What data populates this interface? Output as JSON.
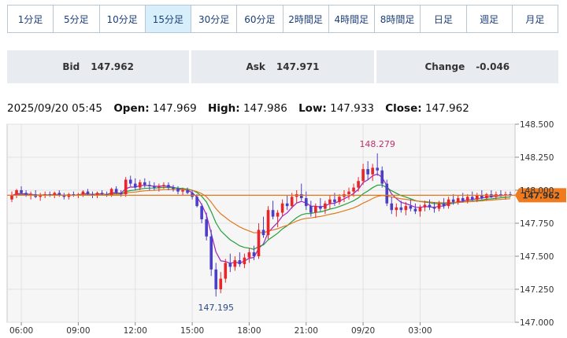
{
  "timeframes": [
    {
      "label": "1分足",
      "active": false
    },
    {
      "label": "5分足",
      "active": false
    },
    {
      "label": "10分足",
      "active": false
    },
    {
      "label": "15分足",
      "active": true
    },
    {
      "label": "30分足",
      "active": false
    },
    {
      "label": "60分足",
      "active": false
    },
    {
      "label": "2時間足",
      "active": false
    },
    {
      "label": "4時間足",
      "active": false
    },
    {
      "label": "8時間足",
      "active": false
    },
    {
      "label": "日足",
      "active": false
    },
    {
      "label": "週足",
      "active": false
    },
    {
      "label": "月足",
      "active": false
    }
  ],
  "quotes": {
    "bid": {
      "label": "Bid",
      "value": "147.962"
    },
    "ask": {
      "label": "Ask",
      "value": "147.971"
    },
    "change": {
      "label": "Change",
      "value": "-0.046"
    }
  },
  "ohlc": {
    "datetime": "2025/09/20 05:45",
    "open_label": "Open:",
    "open": "147.969",
    "high_label": "High:",
    "high": "147.986",
    "low_label": "Low:",
    "low": "147.933",
    "close_label": "Close:",
    "close": "147.962"
  },
  "colors": {
    "up": "#e8262a",
    "down": "#4b3fc8",
    "ma_short": "#a020c0",
    "ma_mid": "#22a03a",
    "ma_long": "#e07a20",
    "price_line": "#e8741a",
    "price_tag": "#f07a1e",
    "high_annotation": "#c0306a",
    "low_annotation": "#2a4a8a",
    "tab_active_bg": "#d6effa"
  },
  "chart_data": {
    "type": "candlestick",
    "ylim": [
      147.0,
      148.5
    ],
    "y_ticks": [
      "148.500",
      "148.250",
      "148.000",
      "147.750",
      "147.500",
      "147.250",
      "147.000"
    ],
    "x_ticks": [
      "06:00",
      "09:00",
      "12:00",
      "15:00",
      "18:00",
      "21:00",
      "09/20",
      "03:00"
    ],
    "current_price": "147.962",
    "annotations": [
      {
        "text": "148.279",
        "kind": "high",
        "value": 148.279
      },
      {
        "text": "147.195",
        "kind": "low",
        "value": 147.195
      }
    ],
    "candles": [
      [
        147.93,
        147.99,
        147.91,
        147.96
      ],
      [
        147.96,
        148.01,
        147.94,
        148.0
      ],
      [
        148.0,
        148.03,
        147.97,
        147.98
      ],
      [
        147.98,
        148.0,
        147.95,
        147.96
      ],
      [
        147.96,
        147.99,
        147.93,
        147.97
      ],
      [
        147.97,
        148.0,
        147.94,
        147.95
      ],
      [
        147.95,
        147.98,
        147.92,
        147.96
      ],
      [
        147.96,
        147.99,
        147.94,
        147.97
      ],
      [
        147.97,
        147.99,
        147.95,
        147.96
      ],
      [
        147.96,
        147.99,
        147.94,
        147.98
      ],
      [
        147.98,
        148.0,
        147.95,
        147.96
      ],
      [
        147.96,
        147.98,
        147.93,
        147.95
      ],
      [
        147.95,
        147.98,
        147.93,
        147.97
      ],
      [
        147.97,
        147.99,
        147.95,
        147.96
      ],
      [
        147.96,
        147.98,
        147.94,
        147.97
      ],
      [
        147.97,
        148.0,
        147.95,
        147.99
      ],
      [
        147.99,
        148.01,
        147.96,
        147.97
      ],
      [
        147.97,
        147.99,
        147.94,
        147.96
      ],
      [
        147.96,
        147.99,
        147.94,
        147.98
      ],
      [
        147.98,
        148.0,
        147.96,
        147.97
      ],
      [
        147.97,
        147.99,
        147.95,
        147.96
      ],
      [
        147.96,
        148.02,
        147.95,
        148.01
      ],
      [
        148.01,
        148.03,
        147.97,
        147.98
      ],
      [
        147.98,
        148.0,
        147.95,
        147.97
      ],
      [
        147.97,
        148.1,
        147.95,
        148.08
      ],
      [
        148.08,
        148.11,
        148.03,
        148.05
      ],
      [
        148.05,
        148.09,
        148.0,
        148.02
      ],
      [
        148.02,
        148.08,
        148.0,
        148.06
      ],
      [
        148.06,
        148.09,
        148.02,
        148.04
      ],
      [
        148.04,
        148.07,
        148.0,
        148.03
      ],
      [
        148.03,
        148.06,
        148.0,
        148.02
      ],
      [
        148.02,
        148.05,
        147.99,
        148.03
      ],
      [
        148.03,
        148.06,
        148.01,
        148.04
      ],
      [
        148.04,
        148.06,
        148.0,
        148.02
      ],
      [
        148.02,
        148.04,
        147.99,
        148.01
      ],
      [
        148.01,
        148.03,
        147.97,
        147.99
      ],
      [
        147.99,
        148.02,
        147.96,
        148.0
      ],
      [
        148.0,
        148.02,
        147.97,
        147.98
      ],
      [
        147.98,
        148.0,
        147.93,
        147.95
      ],
      [
        147.95,
        147.97,
        147.87,
        147.88
      ],
      [
        147.88,
        147.9,
        147.75,
        147.78
      ],
      [
        147.78,
        147.83,
        147.62,
        147.65
      ],
      [
        147.65,
        147.7,
        147.35,
        147.4
      ],
      [
        147.4,
        147.45,
        147.195,
        147.25
      ],
      [
        147.25,
        147.38,
        147.22,
        147.33
      ],
      [
        147.33,
        147.48,
        147.3,
        147.45
      ],
      [
        147.45,
        147.52,
        147.38,
        147.42
      ],
      [
        147.42,
        147.5,
        147.39,
        147.47
      ],
      [
        147.47,
        147.53,
        147.42,
        147.44
      ],
      [
        147.44,
        147.52,
        147.41,
        147.49
      ],
      [
        147.49,
        147.56,
        147.45,
        147.53
      ],
      [
        147.53,
        147.58,
        147.47,
        147.5
      ],
      [
        147.5,
        147.75,
        147.48,
        147.7
      ],
      [
        147.7,
        147.8,
        147.64,
        147.66
      ],
      [
        147.66,
        147.88,
        147.63,
        147.85
      ],
      [
        147.85,
        147.92,
        147.78,
        147.8
      ],
      [
        147.8,
        147.85,
        147.72,
        147.83
      ],
      [
        147.83,
        147.93,
        147.8,
        147.9
      ],
      [
        147.9,
        147.96,
        147.85,
        147.88
      ],
      [
        147.88,
        147.98,
        147.86,
        147.95
      ],
      [
        147.95,
        148.0,
        147.9,
        147.97
      ],
      [
        147.97,
        148.05,
        147.92,
        147.94
      ],
      [
        147.94,
        147.99,
        147.85,
        147.88
      ],
      [
        147.88,
        147.92,
        147.8,
        147.83
      ],
      [
        147.83,
        147.9,
        147.79,
        147.88
      ],
      [
        147.88,
        147.94,
        147.84,
        147.86
      ],
      [
        147.86,
        147.92,
        147.82,
        147.9
      ],
      [
        147.9,
        147.96,
        147.86,
        147.93
      ],
      [
        147.93,
        147.98,
        147.88,
        147.91
      ],
      [
        147.91,
        147.97,
        147.89,
        147.95
      ],
      [
        147.95,
        148.0,
        147.91,
        147.97
      ],
      [
        147.97,
        148.02,
        147.93,
        147.99
      ],
      [
        147.99,
        148.05,
        147.95,
        148.02
      ],
      [
        148.02,
        148.1,
        147.99,
        148.07
      ],
      [
        148.07,
        148.2,
        148.04,
        148.16
      ],
      [
        148.16,
        148.22,
        148.08,
        148.12
      ],
      [
        148.12,
        148.2,
        148.07,
        148.17
      ],
      [
        148.17,
        148.279,
        148.11,
        148.15
      ],
      [
        148.15,
        148.18,
        148.02,
        148.05
      ],
      [
        148.05,
        148.08,
        147.88,
        147.9
      ],
      [
        147.9,
        147.95,
        147.82,
        147.85
      ],
      [
        147.85,
        147.9,
        147.8,
        147.87
      ],
      [
        147.87,
        147.92,
        147.83,
        147.85
      ],
      [
        147.85,
        147.91,
        147.81,
        147.88
      ],
      [
        147.88,
        147.93,
        147.84,
        147.86
      ],
      [
        147.86,
        147.9,
        147.82,
        147.84
      ],
      [
        147.84,
        147.89,
        147.8,
        147.87
      ],
      [
        147.87,
        147.92,
        147.84,
        147.89
      ],
      [
        147.89,
        147.93,
        147.85,
        147.87
      ],
      [
        147.87,
        147.91,
        147.83,
        147.86
      ],
      [
        147.86,
        147.92,
        147.84,
        147.9
      ],
      [
        147.9,
        147.94,
        147.86,
        147.88
      ],
      [
        147.88,
        147.95,
        147.86,
        147.93
      ],
      [
        147.93,
        147.97,
        147.89,
        147.91
      ],
      [
        147.91,
        147.96,
        147.89,
        147.94
      ],
      [
        147.94,
        147.98,
        147.91,
        147.92
      ],
      [
        147.92,
        147.97,
        147.9,
        147.95
      ],
      [
        147.95,
        147.99,
        147.92,
        147.93
      ],
      [
        147.93,
        147.98,
        147.91,
        147.96
      ],
      [
        147.96,
        148.0,
        147.93,
        147.94
      ],
      [
        147.94,
        147.98,
        147.92,
        147.97
      ],
      [
        147.97,
        148.0,
        147.94,
        147.95
      ],
      [
        147.95,
        147.99,
        147.93,
        147.97
      ],
      [
        147.97,
        148.0,
        147.95,
        147.96
      ],
      [
        147.96,
        147.99,
        147.93,
        147.97
      ],
      [
        147.97,
        147.99,
        147.95,
        147.962
      ]
    ]
  }
}
